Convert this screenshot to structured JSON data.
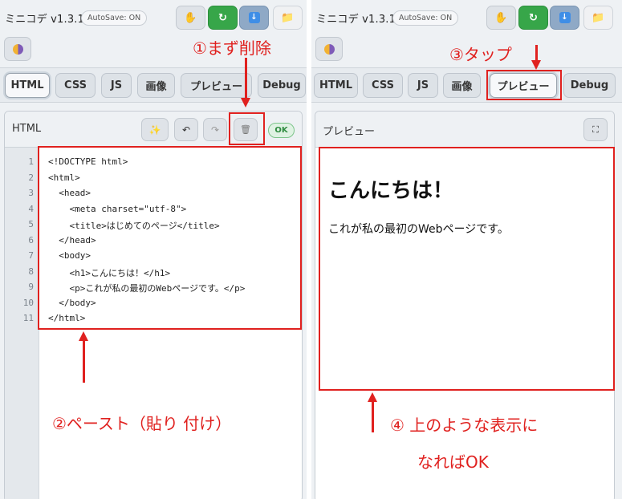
{
  "app": {
    "title": "ミニコデ v1.3.1",
    "autosave": "AutoSave: ON"
  },
  "header_icons": [
    "hand-icon",
    "refresh-icon",
    "download-icon",
    "folder-icon",
    "theme-icon"
  ],
  "tabs": [
    "HTML",
    "CSS",
    "JS",
    "画像",
    "プレビュー",
    "Debug"
  ],
  "editor": {
    "title": "HTML",
    "status": "OK",
    "line_numbers": [
      "1",
      "2",
      "3",
      "4",
      "5",
      "6",
      "7",
      "8",
      "9",
      "10",
      "11"
    ],
    "lines": [
      "<!DOCTYPE html>",
      "<html>",
      "  <head>",
      "    <meta charset=\"utf-8\">",
      "    <title>はじめてのページ</title>",
      "  </head>",
      "  <body>",
      "    <h1>こんにちは！</h1>",
      "    <p>これが私の最初のWebページです。</p>",
      "  </body>",
      "</html>"
    ]
  },
  "preview": {
    "title": "プレビュー",
    "heading": "こんにちは！",
    "paragraph": "これが私の最初のWebページです。"
  },
  "annotations": {
    "step1": "①まず削除",
    "step2": "②ペースト（貼り 付け）",
    "step3": "③タップ",
    "step4_line1": "④ 上のような表示に",
    "step4_line2": "なればOK"
  },
  "colors": {
    "annotation_red": "#e0211f",
    "ok_green": "#2f8c40",
    "run_green": "#37a649"
  }
}
